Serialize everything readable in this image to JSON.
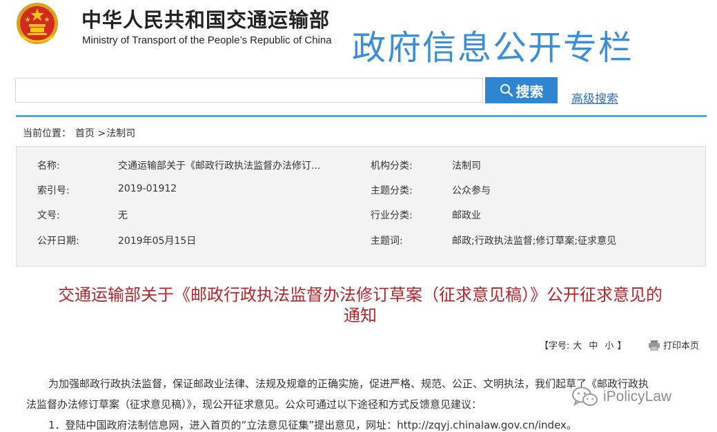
{
  "header": {
    "ministry_name_cn": "中华人民共和国交通运输部",
    "ministry_name_en": "Ministry of Transport of the People’s Republic of China",
    "column_title": "政府信息公开专栏"
  },
  "search": {
    "placeholder": "",
    "button_label": "搜索",
    "advanced_label": "高级搜索"
  },
  "breadcrumb": {
    "prefix": "当前位置：",
    "home": "首页",
    "separator": ">",
    "current": "法制司"
  },
  "info": {
    "name_label": "名称:",
    "name_value": "交通运输部关于《邮政行政执法监督办法修订...",
    "index_label": "索引号:",
    "index_value": "2019-01912",
    "doc_no_label": "文号:",
    "doc_no_value": "无",
    "date_label": "公开日期:",
    "date_value": "2019年05月15日",
    "org_label": "机构分类:",
    "org_value": "法制司",
    "topic_label": "主题分类:",
    "topic_value": "公众参与",
    "industry_label": "行业分类:",
    "industry_value": "邮政业",
    "keywords_label": "主题词:",
    "keywords_value": "邮政;行政执法监督;修订草案;征求意见"
  },
  "article": {
    "title_line1": "交通运输部关于《邮政行政执法监督办法修订草案（征求意见稿）》公开征求意见的",
    "title_line2": "通知",
    "font_size_label": "【字号:",
    "font_large": "大",
    "font_medium": "中",
    "font_small": "小",
    "font_size_close": "】",
    "print_label": "打印本页",
    "para1_line1": "为加强邮政行政执法监督，保证邮政业法律、法规及规章的正确实施，促进严格、规范、公正、文明执法，我们起草了《邮政行政执",
    "para1_line2": "法监督办法修订草案（征求意见稿）》，现公开征求意见。公众可通过以下途径和方式反馈意见建议：",
    "item1": "1．登陆中国政府法制信息网，进入首页的“立法意见征集”提出意见，网址：http://zqyj.chinalaw.gov.cn/index。"
  },
  "watermark": {
    "text": "iPolicyLaw"
  },
  "colors": {
    "brand_blue": "#3a8ed6",
    "button_blue": "#2e85d0",
    "title_red": "#b4262b"
  }
}
